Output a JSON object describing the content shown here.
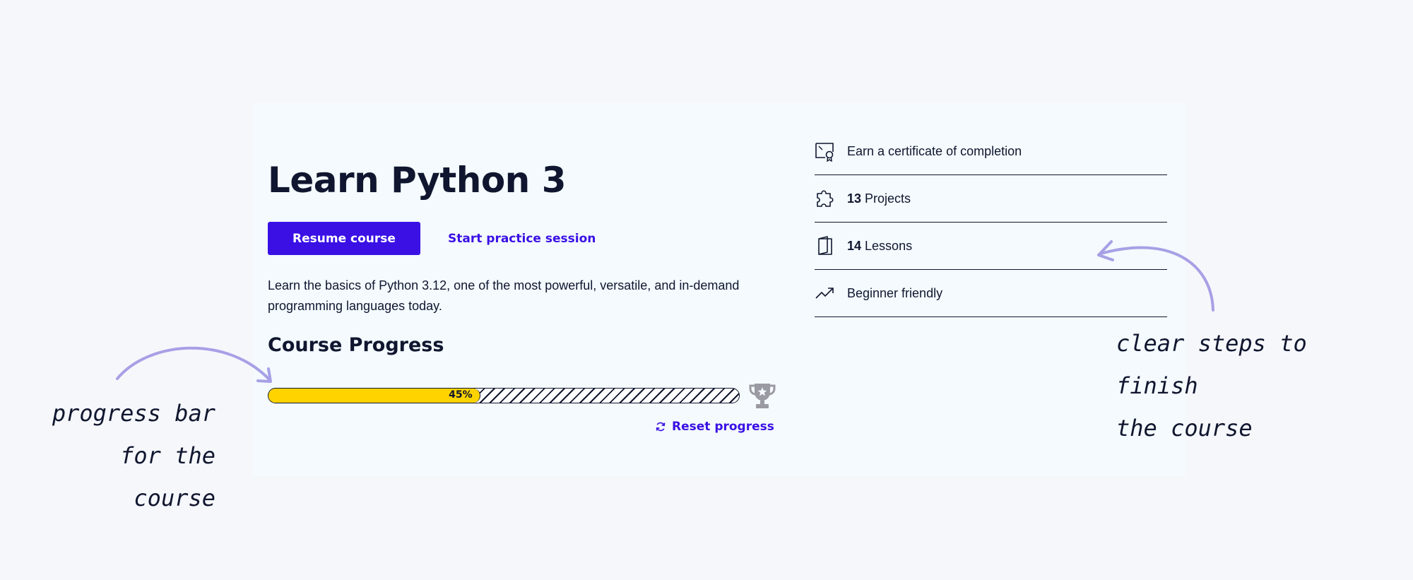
{
  "course": {
    "title": "Learn Python 3",
    "resume_label": "Resume course",
    "practice_label": "Start practice session",
    "description": "Learn the basics of Python 3.12, one of the most powerful, versatile, and in-demand programming languages today.",
    "progress_heading": "Course Progress",
    "progress_percent": 45,
    "progress_label": "45%",
    "reset_label": "Reset progress"
  },
  "features": [
    {
      "icon": "certificate-icon",
      "count": "",
      "label": "Earn a certificate of completion"
    },
    {
      "icon": "puzzle-icon",
      "count": "13",
      "label": "Projects"
    },
    {
      "icon": "book-icon",
      "count": "14",
      "label": "Lessons"
    },
    {
      "icon": "trending-up-icon",
      "count": "",
      "label": "Beginner friendly"
    }
  ],
  "annotations": {
    "left_line1": "progress bar",
    "left_line2": "for the course",
    "right_line1": "clear steps to finish",
    "right_line2": "the course"
  },
  "colors": {
    "accent": "#3a10e5",
    "progress_fill": "#ffd300",
    "annotation_arrow": "#a7a0e6",
    "text": "#10162f"
  }
}
